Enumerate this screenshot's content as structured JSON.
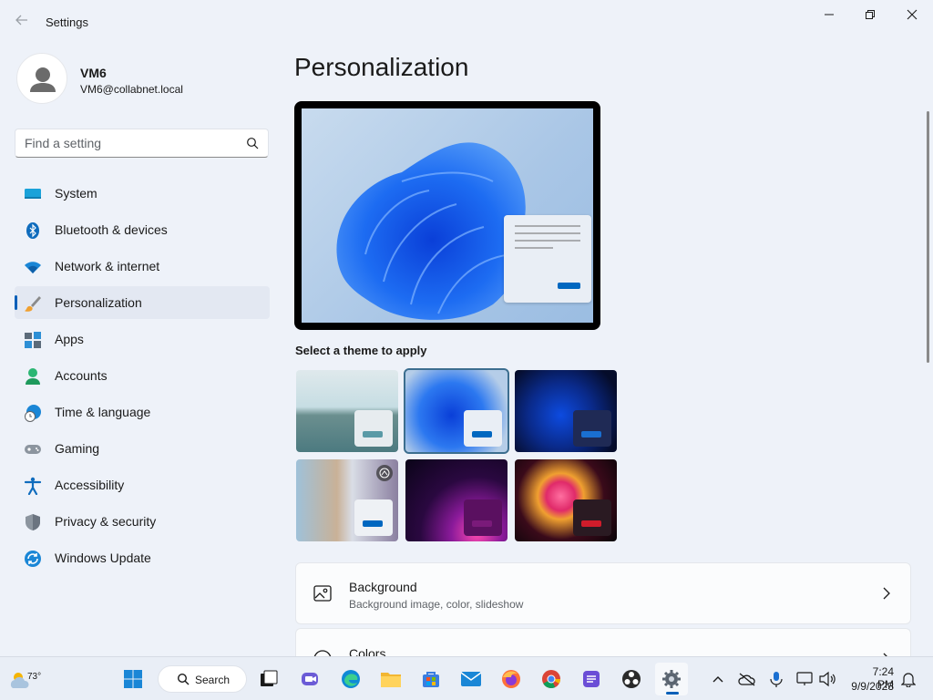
{
  "window": {
    "title": "Settings"
  },
  "profile": {
    "name": "VM6",
    "email": "VM6@collabnet.local"
  },
  "search": {
    "placeholder": "Find a setting"
  },
  "nav": {
    "items": [
      {
        "label": "System",
        "icon": "system-icon"
      },
      {
        "label": "Bluetooth & devices",
        "icon": "bluetooth-icon"
      },
      {
        "label": "Network & internet",
        "icon": "wifi-icon"
      },
      {
        "label": "Personalization",
        "icon": "brush-icon",
        "active": true
      },
      {
        "label": "Apps",
        "icon": "apps-icon"
      },
      {
        "label": "Accounts",
        "icon": "accounts-icon"
      },
      {
        "label": "Time & language",
        "icon": "clock-globe-icon"
      },
      {
        "label": "Gaming",
        "icon": "gamepad-icon"
      },
      {
        "label": "Accessibility",
        "icon": "accessibility-icon"
      },
      {
        "label": "Privacy & security",
        "icon": "shield-icon"
      },
      {
        "label": "Windows Update",
        "icon": "update-icon"
      }
    ]
  },
  "main": {
    "title": "Personalization",
    "theme_label": "Select a theme to apply",
    "themes": [
      {
        "name": "glow-lake",
        "selected": false,
        "accent": "#5a9aa6"
      },
      {
        "name": "windows-light",
        "selected": true,
        "accent": "#0067c0"
      },
      {
        "name": "windows-dark",
        "selected": false,
        "accent": "#1a6fd1"
      },
      {
        "name": "captured-motion",
        "selected": false,
        "accent": "#0067c0"
      },
      {
        "name": "glow",
        "selected": false,
        "accent": "#7a1a7a"
      },
      {
        "name": "flow",
        "selected": false,
        "accent": "#d01c2b"
      }
    ],
    "cards": [
      {
        "title": "Background",
        "subtitle": "Background image, color, slideshow",
        "icon": "image-icon"
      },
      {
        "title": "Colors",
        "subtitle": "",
        "icon": "palette-icon"
      }
    ]
  },
  "taskbar": {
    "weather": "73°",
    "search_label": "Search",
    "time": "7:24 PM",
    "date": "9/9/2023"
  },
  "colors": {
    "accent": "#005fb8",
    "background": "#eef2f9"
  }
}
